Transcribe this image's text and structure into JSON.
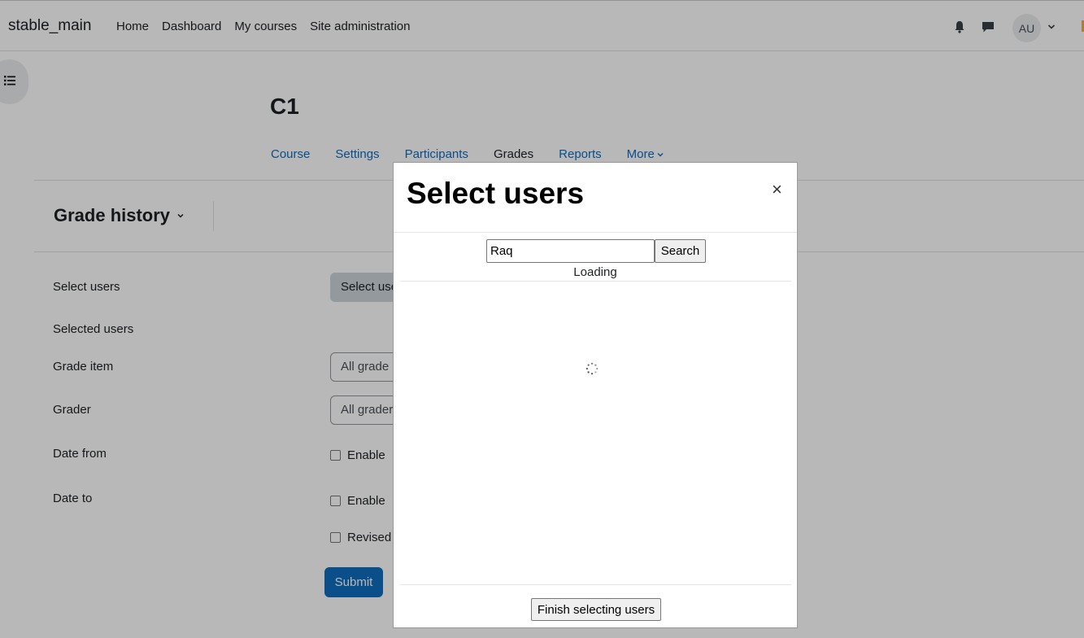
{
  "navbar": {
    "brand": "stable_main",
    "items": [
      "Home",
      "Dashboard",
      "My courses",
      "Site administration"
    ],
    "avatar_initials": "AU",
    "icons": [
      "bell-icon",
      "chat-icon",
      "chevron-down-icon"
    ]
  },
  "course": {
    "title": "C1",
    "tabs": [
      {
        "label": "Course",
        "active": false
      },
      {
        "label": "Settings",
        "active": false
      },
      {
        "label": "Participants",
        "active": false
      },
      {
        "label": "Grades",
        "active": true
      },
      {
        "label": "Reports",
        "active": false
      },
      {
        "label": "More",
        "active": false
      }
    ]
  },
  "page": {
    "heading": "Grade history"
  },
  "form": {
    "select_users_label": "Select users",
    "select_users_button": "Select users",
    "selected_users_label": "Selected users",
    "grade_item_label": "Grade item",
    "grade_item_value": "All grade items",
    "grader_label": "Grader",
    "grader_value": "All graders",
    "date_from_label": "Date from",
    "date_to_label": "Date to",
    "enable_label": "Enable",
    "revised_label": "Revised grades only",
    "submit_label": "Submit"
  },
  "modal": {
    "title": "Select users",
    "close_glyph": "×",
    "search_value": "Raq",
    "search_button": "Search",
    "status_text": "Loading",
    "finish_button": "Finish selecting users"
  },
  "colors": {
    "link": "#0f6cbf",
    "primary_button": "#0f6cbf",
    "backdrop": "rgba(0,0,0,0.28)"
  }
}
